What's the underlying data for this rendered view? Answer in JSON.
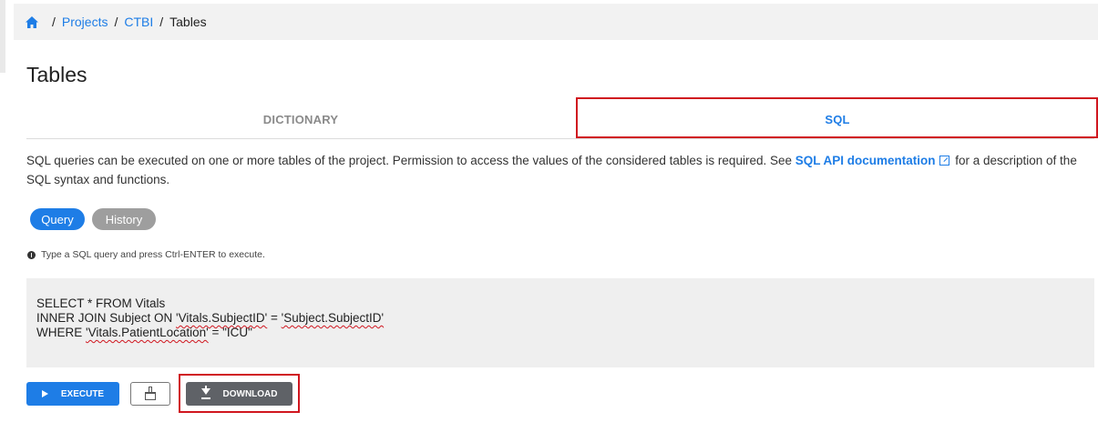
{
  "breadcrumb": {
    "items": [
      "Projects",
      "CTBI"
    ],
    "current": "Tables",
    "separator": "/"
  },
  "page": {
    "title": "Tables"
  },
  "tabs": [
    {
      "label": "DICTIONARY",
      "active": false
    },
    {
      "label": "SQL",
      "active": true
    }
  ],
  "description": {
    "text_before": "SQL queries can be executed on one or more tables of the project. Permission to access the values of the considered tables is required. See ",
    "link_text": "SQL API documentation",
    "text_after": " for a description of the SQL syntax and functions."
  },
  "modes": {
    "query_label": "Query",
    "history_label": "History"
  },
  "hint": "Type a SQL query and press Ctrl-ENTER to execute.",
  "editor": {
    "line1": "SELECT * FROM Vitals",
    "line2_a": "INNER JOIN Subject ON ",
    "line2_b": "'Vitals.SubjectID'",
    "line2_c": " = ",
    "line2_d": "'Subject.SubjectID'",
    "line3_a": "WHERE ",
    "line3_b": "'Vitals.PatientLocation'",
    "line3_c": " = \"ICU\""
  },
  "actions": {
    "execute_label": "EXECUTE",
    "download_label": "DOWNLOAD"
  },
  "colors": {
    "primary": "#1e7de6",
    "highlight": "#d0161f",
    "download_bg": "#5f6267",
    "history_bg": "#9e9e9e"
  }
}
